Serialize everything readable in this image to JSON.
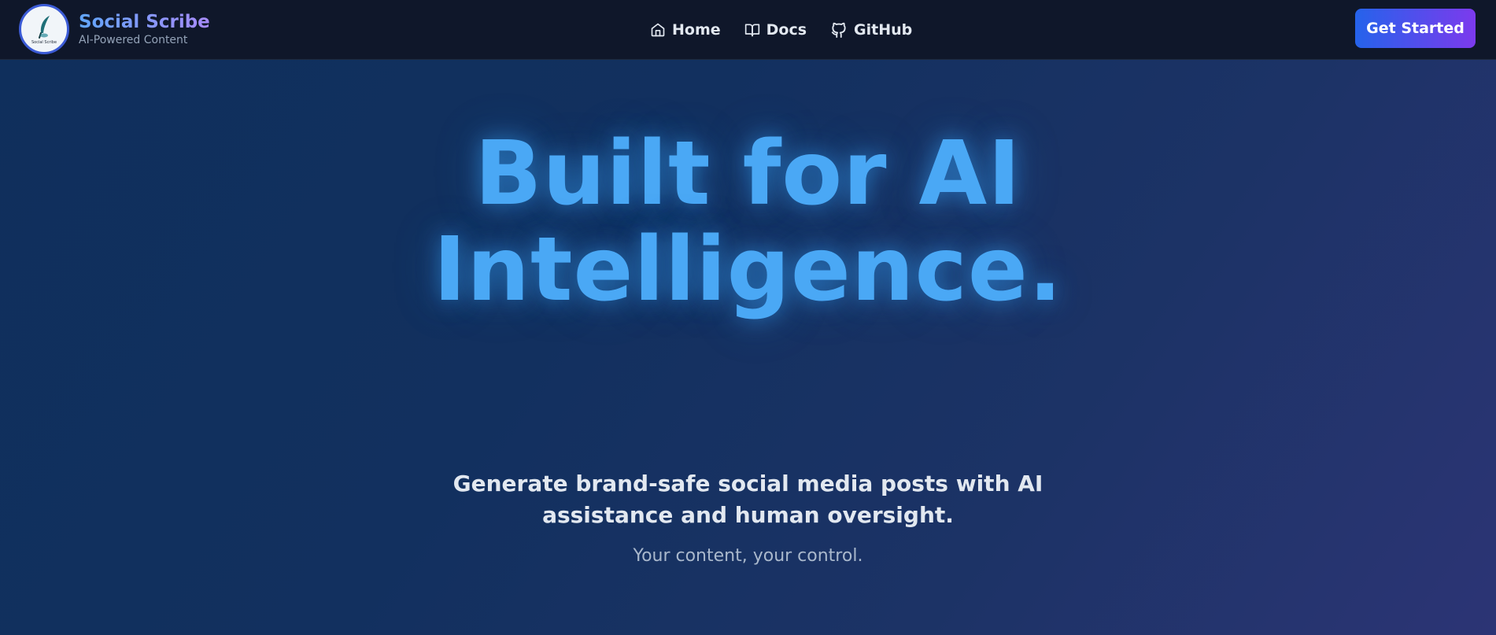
{
  "brand": {
    "title": "Social Scribe",
    "subtitle": "AI-Powered Content",
    "logo_text": "Social Scribe",
    "logo_icon": "feather-quill-icon"
  },
  "nav": {
    "items": [
      {
        "label": "Home",
        "icon": "home-icon"
      },
      {
        "label": "Docs",
        "icon": "book-open-icon"
      },
      {
        "label": "GitHub",
        "icon": "github-icon"
      }
    ],
    "cta_label": "Get Started"
  },
  "hero": {
    "title_line1": "Built for AI",
    "title_line2": "Intelligence.",
    "description": "Generate brand-safe social media posts with AI assistance and human oversight.",
    "tagline": "Your content, your control."
  },
  "colors": {
    "navbar_bg": "#0f172a",
    "accent_blue": "#2563eb",
    "accent_purple": "#7c3aed",
    "hero_title": "#4aa8f5"
  }
}
